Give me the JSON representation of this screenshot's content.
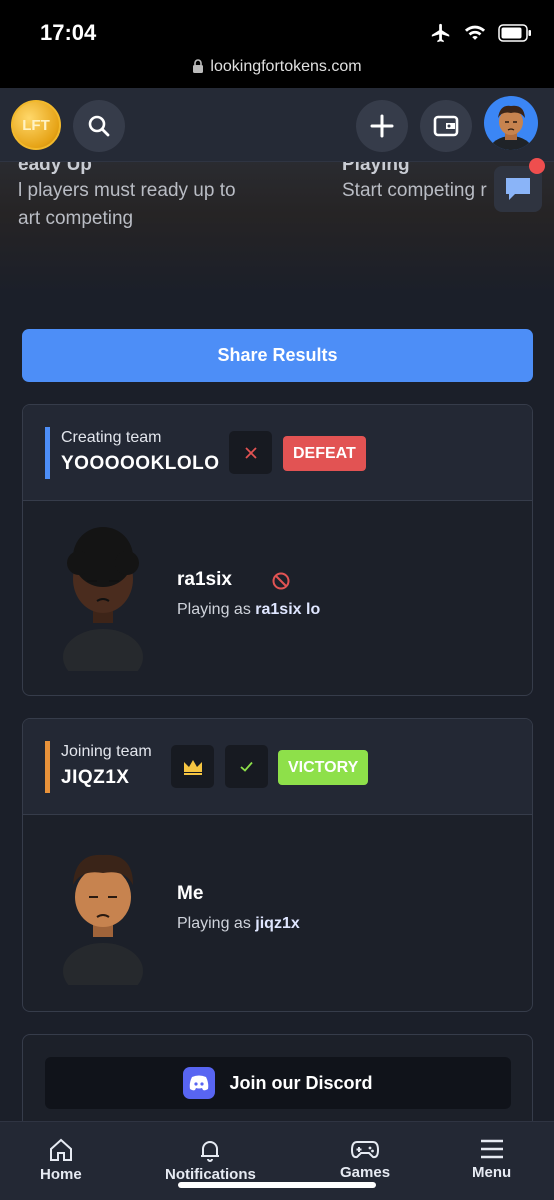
{
  "status_bar": {
    "time": "17:04",
    "url": "lookingfortokens.com"
  },
  "header": {
    "logo_text": "LFT",
    "icons": [
      "search-icon",
      "plus-icon",
      "wallet-icon",
      "profile-avatar"
    ]
  },
  "hero": {
    "steps": [
      {
        "title": "eady Up",
        "desc_line1": "l players must ready up to",
        "desc_line2": "art competing"
      },
      {
        "title": "Playing",
        "desc_line1": "Start competing r",
        "desc_line2": ""
      }
    ]
  },
  "share_button": "Share Results",
  "teams": [
    {
      "label": "Creating team",
      "name": "YOOOOOKLOLO",
      "accent": "#4d8ef7",
      "result": "DEFEAT",
      "result_color": "#e25353",
      "player": {
        "name": "ra1six",
        "playing_as_prefix": "Playing as",
        "playing_as": "ra1six lo"
      }
    },
    {
      "label": "Joining team",
      "name": "JIQZ1X",
      "accent": "#e8923a",
      "result": "VICTORY",
      "result_color": "#8ee04a",
      "player": {
        "name": "Me",
        "playing_as_prefix": "Playing as",
        "playing_as": "jiqz1x"
      }
    }
  ],
  "discord_button": "Join our Discord",
  "bottom_nav": [
    {
      "label": "Home",
      "icon": "home-icon"
    },
    {
      "label": "Notifications",
      "icon": "bell-icon"
    },
    {
      "label": "Games",
      "icon": "gamepad-icon"
    },
    {
      "label": "Menu",
      "icon": "menu-icon"
    }
  ]
}
